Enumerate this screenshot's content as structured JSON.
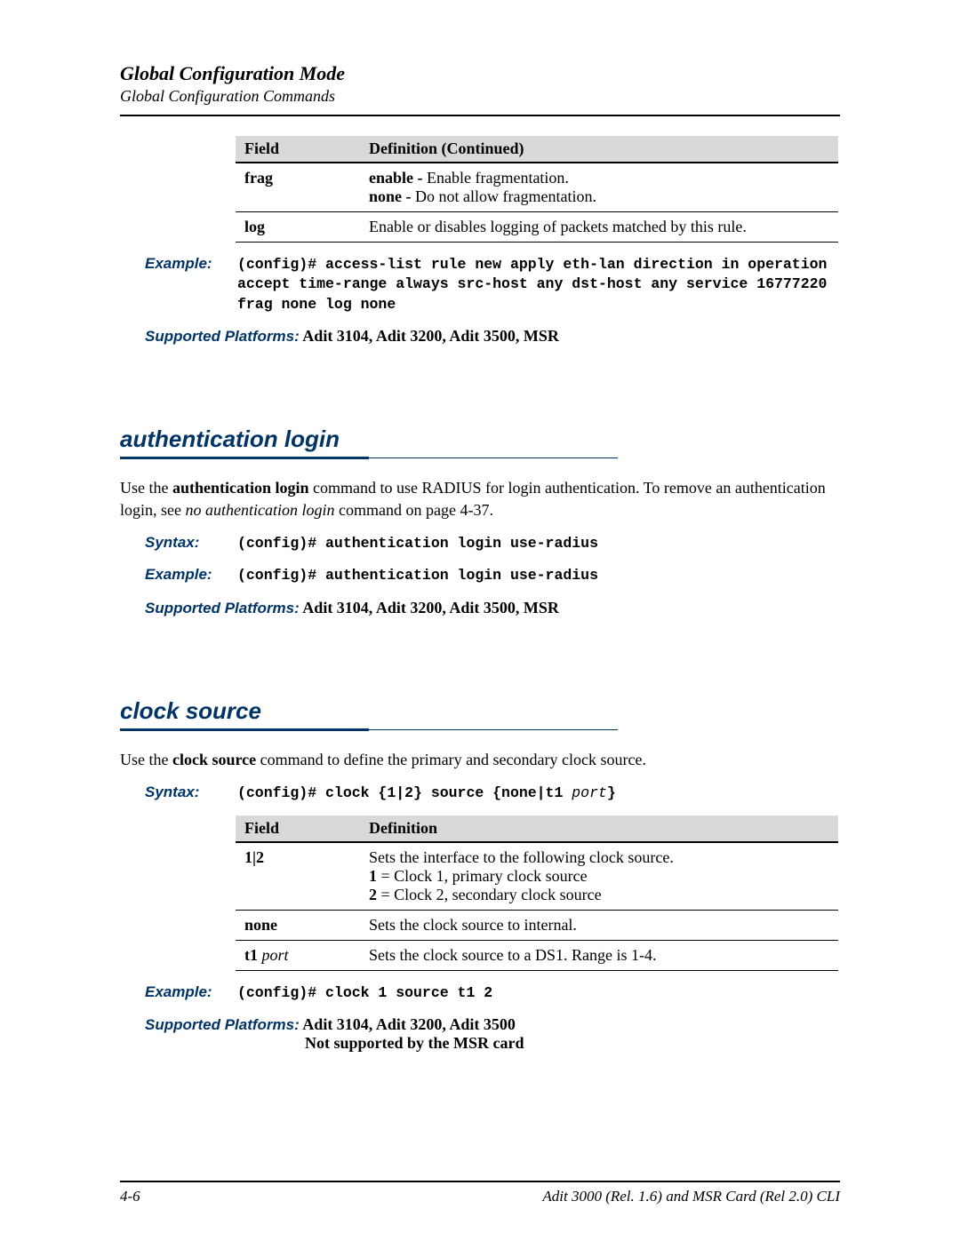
{
  "header": {
    "title": "Global Configuration Mode",
    "subtitle": "Global Configuration Commands"
  },
  "table1": {
    "h1": "Field",
    "h2": "Definition (Continued)",
    "rows": [
      {
        "field": "frag",
        "def_b1": "enable - ",
        "def_t1": "Enable fragmentation.",
        "def_b2": "none - ",
        "def_t2": "Do not allow fragmentation."
      },
      {
        "field": "log",
        "def_t1": "Enable or disables logging of packets matched by this rule."
      }
    ]
  },
  "example1": {
    "label": "Example:",
    "text": "(config)# access-list rule new apply eth-lan direction in operation accept time-range always src-host any dst-host any service 16777220 frag none log none"
  },
  "supported1": {
    "label": "Supported Platforms:",
    "value": " Adit 3104, Adit 3200, Adit 3500, MSR"
  },
  "auth": {
    "heading": "authentication login",
    "body_pre": "Use the ",
    "body_bold": "authentication login",
    "body_mid": " command to use RADIUS for login authentication. To remove an authentication login, see ",
    "body_ital": "no authentication login",
    "body_post": " command on page 4-37.",
    "syntax_label": "Syntax:",
    "syntax_val": "(config)# authentication login use-radius",
    "example_label": "Example:",
    "example_val": "(config)# authentication login use-radius",
    "supported_label": "Supported Platforms:",
    "supported_val": " Adit 3104, Adit 3200, Adit 3500, MSR"
  },
  "clock": {
    "heading": "clock source",
    "body_pre": "Use the ",
    "body_bold": "clock source",
    "body_post": " command to define the primary and secondary clock source.",
    "syntax_label": "Syntax:",
    "syntax_val_pre": "(config)# clock {1|2} source {none|t1 ",
    "syntax_val_ital": "port",
    "syntax_val_post": "}",
    "table": {
      "h1": "Field",
      "h2": "Definition",
      "rows": [
        {
          "field": "1|2",
          "l1": "Sets the interface to the following clock source.",
          "b2": "1",
          "t2": " = Clock 1, primary clock source",
          "b3": "2",
          "t3": " = Clock 2, secondary clock source"
        },
        {
          "field": "none",
          "l1": "Sets the clock source to internal."
        },
        {
          "field_b": "t1 ",
          "field_i": "port",
          "l1": "Sets the clock source to a DS1. Range is 1-4."
        }
      ]
    },
    "example_label": "Example:",
    "example_val": "(config)# clock 1 source t1 2",
    "supported_label": "Supported Platforms:",
    "supported_val": " Adit 3104, Adit 3200, Adit 3500",
    "not_supported": "Not supported by the MSR card"
  },
  "footer": {
    "left": "4-6",
    "right": "Adit 3000 (Rel. 1.6) and MSR Card (Rel 2.0) CLI"
  }
}
